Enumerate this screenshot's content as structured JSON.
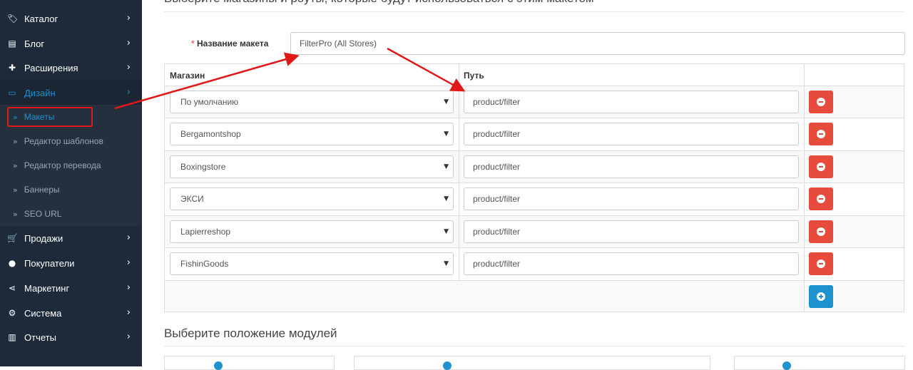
{
  "sidebar": {
    "items": [
      {
        "label": "Каталог",
        "icon": "tag-icon",
        "glyph": "🏷"
      },
      {
        "label": "Блог",
        "icon": "book-icon",
        "glyph": "▤"
      },
      {
        "label": "Расширения",
        "icon": "puzzle-icon",
        "glyph": "✚"
      },
      {
        "label": "Дизайн",
        "icon": "monitor-icon",
        "glyph": "▭"
      },
      {
        "label": "Продажи",
        "icon": "cart-icon",
        "glyph": "🛒"
      },
      {
        "label": "Покупатели",
        "icon": "user-icon",
        "glyph": "●"
      },
      {
        "label": "Маркетинг",
        "icon": "share-icon",
        "glyph": "⋖"
      },
      {
        "label": "Система",
        "icon": "gear-icon",
        "glyph": "⚙"
      },
      {
        "label": "Отчеты",
        "icon": "bar-chart-icon",
        "glyph": "▥"
      }
    ],
    "chevron": "›",
    "design_subitems": [
      {
        "label": "Макеты"
      },
      {
        "label": "Редактор шаблонов"
      },
      {
        "label": "Редактор перевода"
      },
      {
        "label": "Баннеры"
      },
      {
        "label": "SEO URL"
      }
    ],
    "sub_bullet": "»"
  },
  "main": {
    "top_heading": "Выберите магазины и роуты, которые будут использоваться с этим макетом",
    "layout_name": {
      "label": "Название макета",
      "required_mark": "*",
      "value": "FilterPro (All Stores)"
    },
    "table": {
      "headers": [
        "Магазин",
        "Путь"
      ],
      "rows": [
        {
          "store": "По умолчанию",
          "route": "product/filter"
        },
        {
          "store": "Bergamontshop",
          "route": "product/filter"
        },
        {
          "store": "Boxingstore",
          "route": "product/filter"
        },
        {
          "store": "ЭКСИ",
          "route": "product/filter"
        },
        {
          "store": "Lapierreshop",
          "route": "product/filter"
        },
        {
          "store": "FishinGoods",
          "route": "product/filter"
        }
      ],
      "caret": "▼"
    },
    "modules_heading": "Выберите положение модулей"
  },
  "colors": {
    "sidebar_bg": "#1e2a3a",
    "accent": "#1e91cf",
    "danger": "#e74b3c",
    "annotation": "#e01818"
  }
}
